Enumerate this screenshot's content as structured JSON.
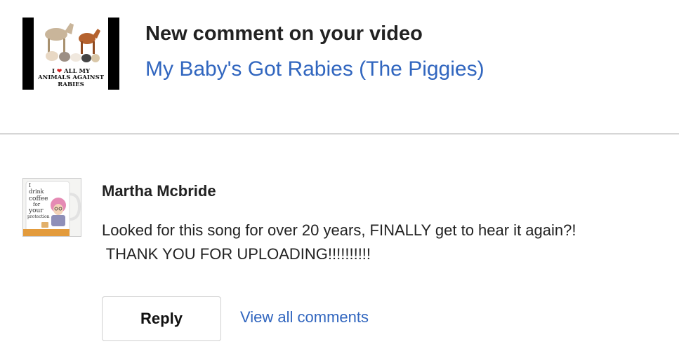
{
  "notification": {
    "title": "New comment on your video",
    "video_title": "My Baby's Got Rabies (The Piggies)",
    "thumbnail": {
      "text_line1_prefix": "I",
      "text_line1_icon": "heart-icon",
      "text_line1_suffix": "ALL MY",
      "text_line2": "ANIMALS AGAINST",
      "text_line3": "RABIES"
    }
  },
  "comment": {
    "author": "Martha Mcbride",
    "text_line1": "Looked for this song for over 20 years, FINALLY get to hear it again?!",
    "text_line2": " THANK YOU FOR UPLOADING!!!!!!!!!!",
    "avatar_mug_text": [
      "I",
      "drink",
      "coffee",
      "for",
      "your",
      "protection"
    ]
  },
  "actions": {
    "reply_label": "Reply",
    "view_all_label": "View all comments"
  },
  "colors": {
    "link": "#3166bf",
    "text": "#222222",
    "divider": "#d6d6d6",
    "heart": "#d21f1f"
  }
}
